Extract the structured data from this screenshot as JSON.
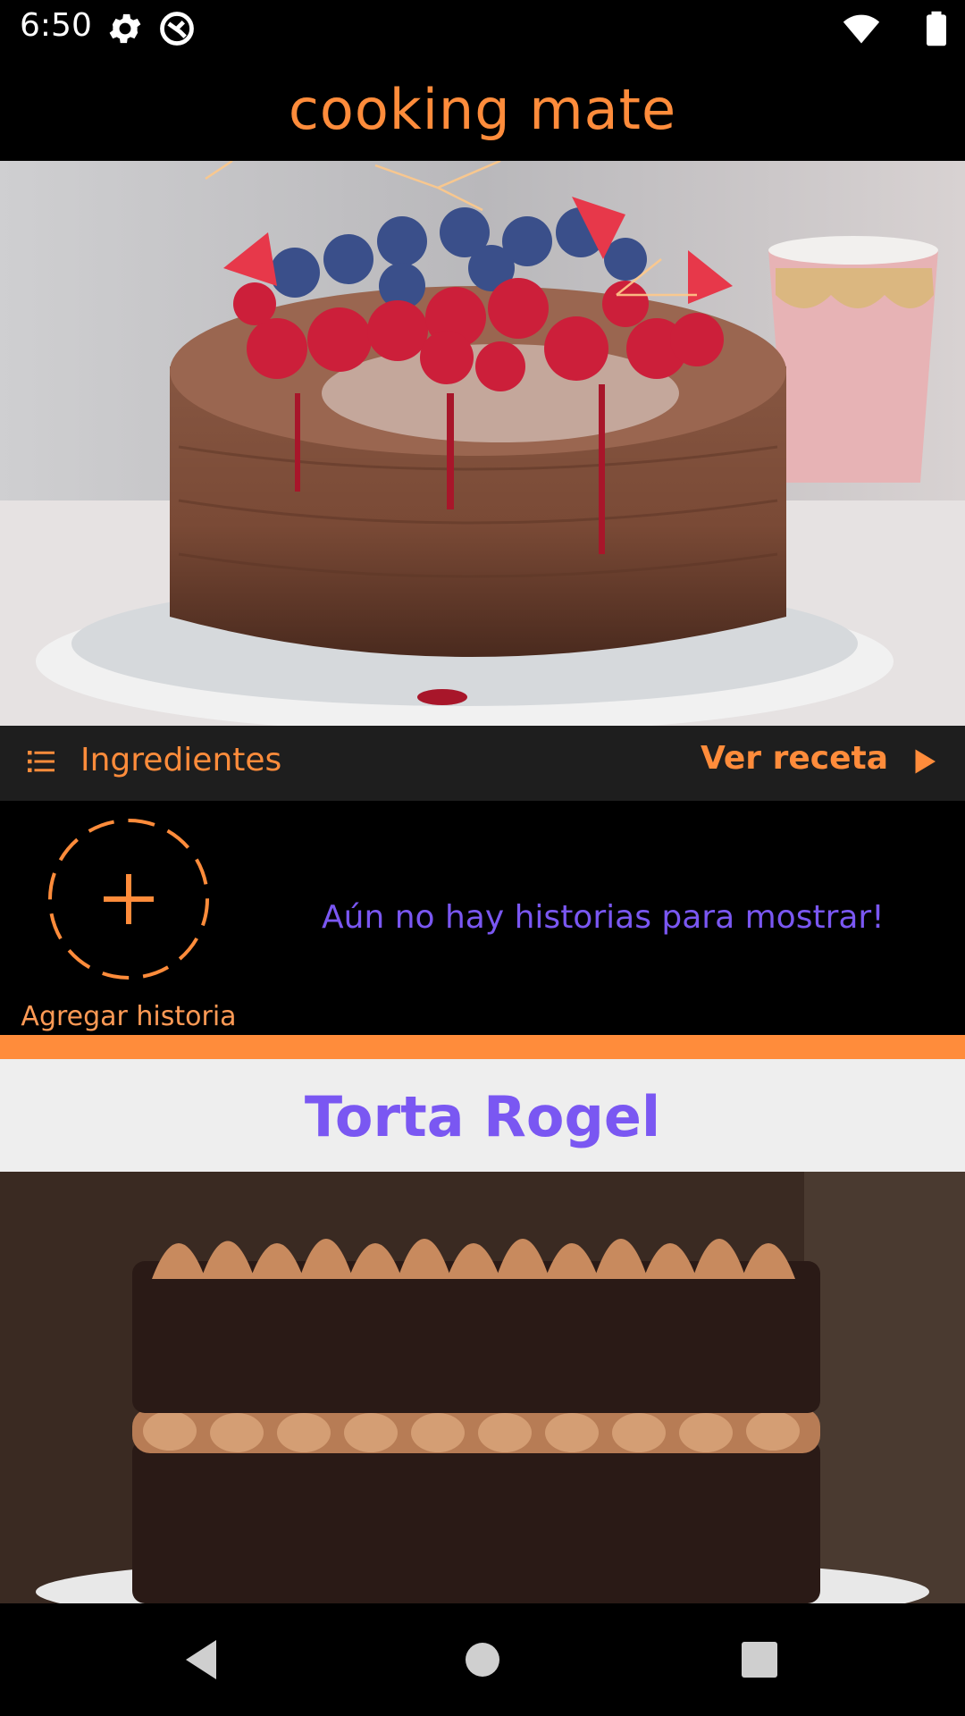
{
  "status_bar": {
    "time": "6:50",
    "icons": [
      "gear-icon",
      "sync-icon",
      "wifi-icon",
      "battery-icon"
    ]
  },
  "app": {
    "title": "cooking mate",
    "accent_color": "#ff8c3b",
    "secondary_color": "#7a57f2"
  },
  "recipe_card": {
    "ingredients_label": "Ingredientes",
    "view_recipe_label": "Ver receta"
  },
  "stories": {
    "add_label": "Agregar historia",
    "empty_message": "Aún no hay historias para mostrar!"
  },
  "next_recipe": {
    "title": "Torta Rogel"
  },
  "nav_bar": {
    "buttons": [
      "back-icon",
      "home-icon",
      "recents-icon"
    ]
  }
}
